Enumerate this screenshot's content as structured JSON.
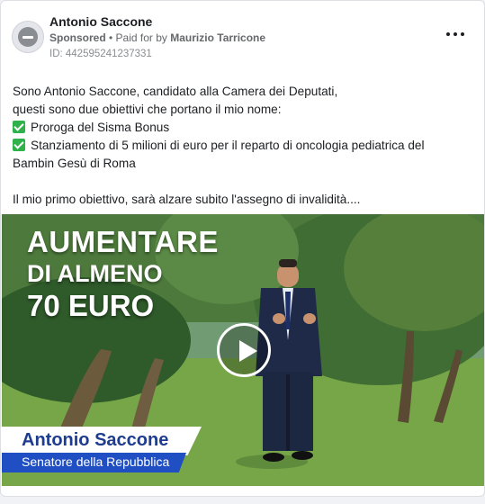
{
  "post": {
    "page_name": "Antonio Saccone",
    "sponsored_label": "Sponsored",
    "separator": " • Paid for by ",
    "payer": "Maurizio Tarricone",
    "ad_id": "ID: 442595241237331",
    "menu_icon": "more-horizontal-icon"
  },
  "body": {
    "line1": "Sono Antonio Saccone, candidato alla Camera dei Deputati,",
    "line2": "questi sono due obiettivi che portano il mio nome:",
    "bullet1": "Proroga del Sisma Bonus",
    "bullet2a": "Stanziamento di 5 milioni di euro per il reparto di oncologia pediatrica del",
    "bullet2b": "Bambin Gesù di Roma",
    "line_last": "Il mio primo obiettivo, sarà alzare subito l'assegno di invalidità...."
  },
  "video": {
    "headline1": "AUMENTARE",
    "headline2": "DI ALMENO",
    "headline3": "70 EURO",
    "lower_name": "Antonio Saccone",
    "lower_role": "Senatore della Repubblica",
    "play_icon": "play-icon"
  },
  "colors": {
    "check": "#2fb24c",
    "name_text": "#1d3c8f",
    "role_bar": "#1f4fc2"
  }
}
